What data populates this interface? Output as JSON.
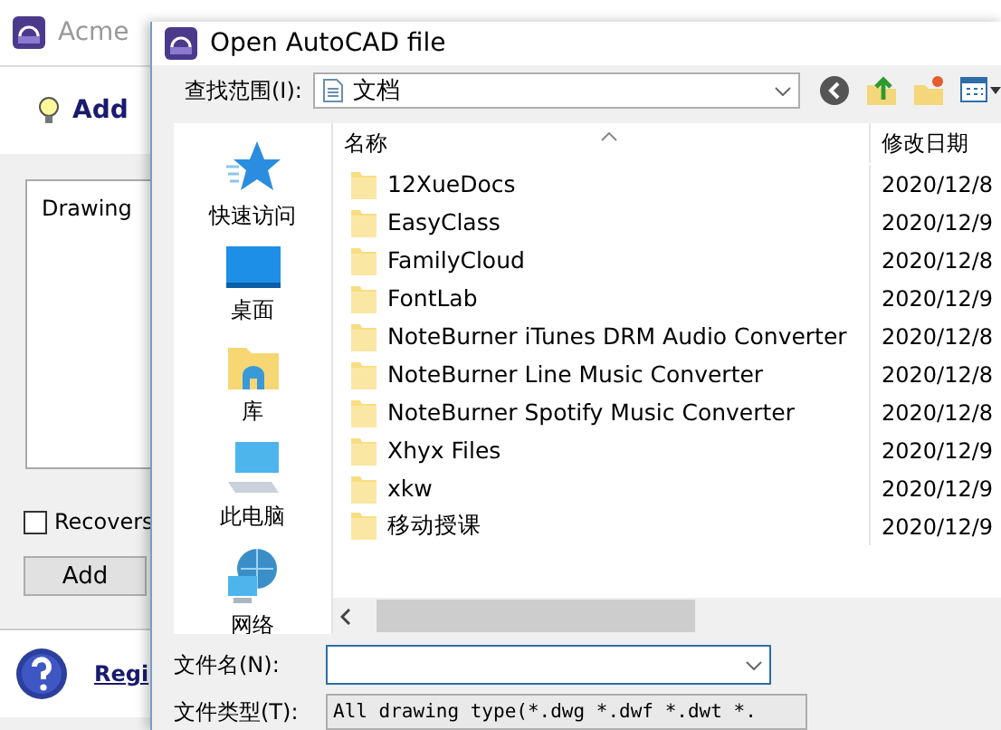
{
  "background_window": {
    "title": "Acme",
    "heading": "Add",
    "list_label": "Drawing",
    "checkbox": {
      "label": "Recovers",
      "checked": false
    },
    "add_button": "Add",
    "register_link": "Regi"
  },
  "dialog": {
    "title": "Open AutoCAD file",
    "look_in": {
      "label": "查找范围(I):",
      "value": "文档"
    },
    "places": [
      {
        "kind": "quick",
        "label": "快速访问"
      },
      {
        "kind": "desktop",
        "label": "桌面"
      },
      {
        "kind": "library",
        "label": "库"
      },
      {
        "kind": "computer",
        "label": "此电脑"
      },
      {
        "kind": "network",
        "label": "网络"
      }
    ],
    "columns": [
      "名称",
      "修改日期"
    ],
    "rows": [
      {
        "name": "12XueDocs",
        "date": "2020/12/8"
      },
      {
        "name": "EasyClass",
        "date": "2020/12/9"
      },
      {
        "name": "FamilyCloud",
        "date": "2020/12/8"
      },
      {
        "name": "FontLab",
        "date": "2020/12/9"
      },
      {
        "name": "NoteBurner iTunes DRM Audio Converter",
        "date": "2020/12/8"
      },
      {
        "name": "NoteBurner Line Music Converter",
        "date": "2020/12/8"
      },
      {
        "name": "NoteBurner Spotify Music Converter",
        "date": "2020/12/8"
      },
      {
        "name": "Xhyx Files",
        "date": "2020/12/9"
      },
      {
        "name": "xkw",
        "date": "2020/12/9"
      },
      {
        "name": "移动授课",
        "date": "2020/12/9"
      }
    ],
    "file_name_label": "文件名(N):",
    "file_type_label": "文件类型(T):",
    "file_type": "All drawing type(*.dwg *.dwf *.dwt *."
  }
}
